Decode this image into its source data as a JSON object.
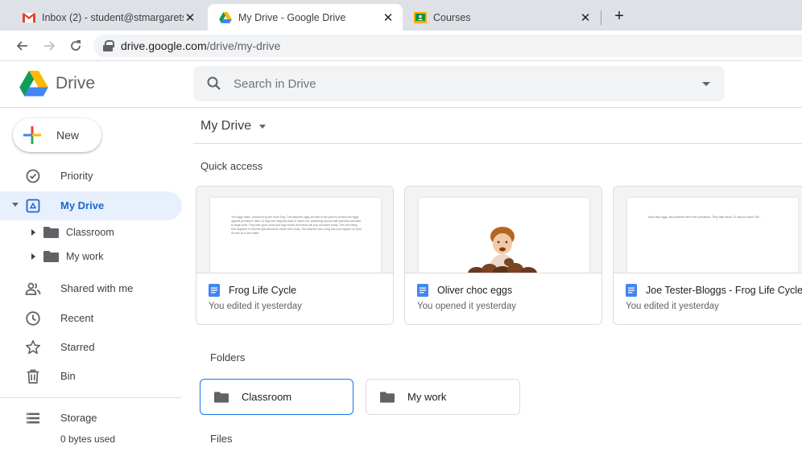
{
  "browser": {
    "tabs": [
      {
        "title": "Inbox (2) - student@stmargarets",
        "active": false
      },
      {
        "title": "My Drive - Google Drive",
        "active": true
      },
      {
        "title": "Courses",
        "active": false
      }
    ],
    "close_glyph": "✕",
    "new_tab_glyph": "+",
    "url_host": "drive.google.com",
    "url_path": "/drive/my-drive"
  },
  "header": {
    "brand": "Drive",
    "search_placeholder": "Search in Drive"
  },
  "sidebar": {
    "new_label": "New",
    "items": [
      {
        "label": "Priority",
        "icon": "priority-icon"
      },
      {
        "label": "My Drive",
        "icon": "my-drive-icon",
        "active": true
      },
      {
        "label": "Shared with me",
        "icon": "shared-icon"
      },
      {
        "label": "Recent",
        "icon": "clock-icon"
      },
      {
        "label": "Starred",
        "icon": "star-icon"
      },
      {
        "label": "Bin",
        "icon": "bin-icon"
      },
      {
        "label": "Storage",
        "icon": "storage-icon"
      }
    ],
    "tree": [
      {
        "label": "Classroom"
      },
      {
        "label": "My work"
      }
    ],
    "storage_used": "0 bytes used"
  },
  "main": {
    "title": "My Drive",
    "quick_access_label": "Quick access",
    "quick_access": [
      {
        "name": "Frog Life Cycle",
        "subtitle": "You edited it yesterday",
        "snippet": "The eggs hatch, produced by the mum frog. The tadpoles eggs are laid in the pond to protect the eggs against predators. After 10 days the tadpoles start to hatch out, swimming around with just tails and start to begin with. They later grow arms and legs inside and these will pop out when ready. The next thing that happens is that the gills absorbed inside their body. The tadpole now a frog can now explore on land as well as in the water."
      },
      {
        "name": "Oliver choc eggs",
        "subtitle": "You opened it yesterday"
      },
      {
        "name": "Joe Tester-Bloggs - Frog Life Cycle",
        "subtitle": "You edited it yesterday",
        "snippet": "Mum lays eggs, dad protects them from predators. They take about 10 days to hatch. Etc..."
      }
    ],
    "folders_label": "Folders",
    "folders": [
      {
        "name": "Classroom",
        "selected": true
      },
      {
        "name": "My work",
        "selected": false
      }
    ],
    "files_label": "Files"
  },
  "colors": {
    "accent": "#1a73e8",
    "active_nav_bg": "#e8f0fe",
    "doc_blue": "#4285f4",
    "gmail_red": "#ea4335",
    "classroom_yellow": "#f9ab00",
    "classroom_green": "#1e8e3e"
  }
}
